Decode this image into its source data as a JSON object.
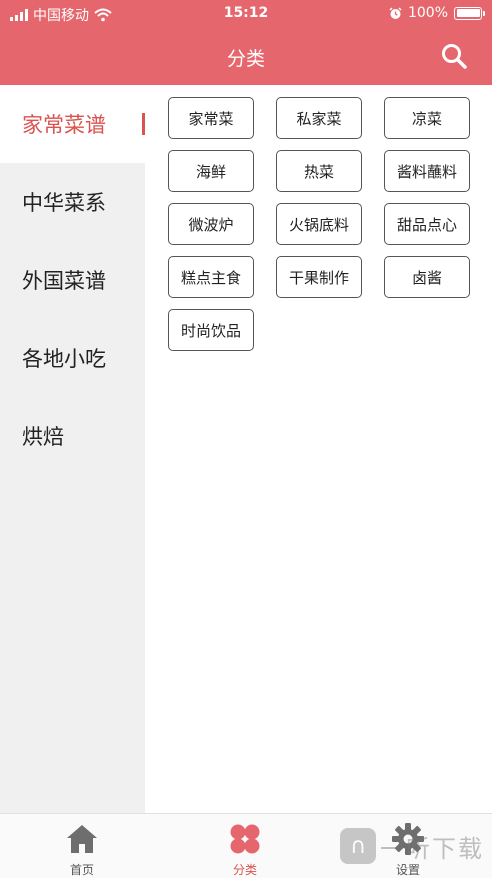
{
  "status_bar": {
    "carrier": "中国移动",
    "time": "15:12",
    "battery": "100%",
    "battery_level": 1.0
  },
  "nav": {
    "title": "分类",
    "search_icon": "search-icon"
  },
  "sidebar": {
    "items": [
      {
        "label": "家常菜谱",
        "active": true
      },
      {
        "label": "中华菜系",
        "active": false
      },
      {
        "label": "外国菜谱",
        "active": false
      },
      {
        "label": "各地小吃",
        "active": false
      },
      {
        "label": "烘焙",
        "active": false
      }
    ]
  },
  "tags": [
    "家常菜",
    "私家菜",
    "凉菜",
    "海鲜",
    "热菜",
    "酱料蘸料",
    "微波炉",
    "火锅底料",
    "甜品点心",
    "糕点主食",
    "干果制作",
    "卤酱",
    "时尚饮品"
  ],
  "tabbar": {
    "items": [
      {
        "label": "首页",
        "icon": "home-icon",
        "active": false
      },
      {
        "label": "分类",
        "icon": "category-icon",
        "active": true
      },
      {
        "label": "设置",
        "icon": "gear-icon",
        "active": false
      }
    ]
  },
  "watermark": {
    "text": "一听下载"
  },
  "colors": {
    "accent": "#e5676d",
    "active_text": "#d9534f"
  }
}
